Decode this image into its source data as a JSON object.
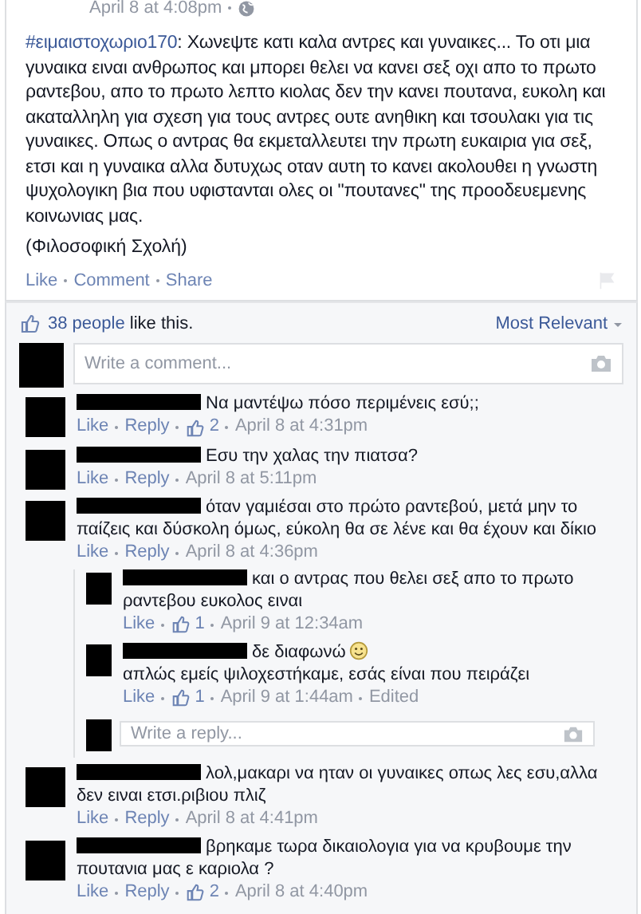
{
  "post": {
    "timestamp": "April 8 at 4:08pm",
    "hashtag": "#ειμαιστοχωριο170",
    "body": ": Χωνεψτε κατι καλα αντρες και γυναικες... Το οτι μια γυναικα ειναι ανθρωπος και μπορει θελει να κανει σεξ οχι απο το πρωτο ραντεβου, απο το πρωτο λεπτο κιολας δεν την κανει πουτανα, ευκολη και ακαταλληλη για σχεση για τους αντρες ουτε ανηθικη και τσουλακι για τις γυναικες. Οπως ο αντρας θα εκμεταλλευτει την πρωτη ευκαιρια για σεξ, ετσι και η γυναικα αλλα δυτυχως οταν αυτη το κανει ακολουθει η γνωστη ψυχολογικη βια που υφιστανται ολες οι \"πουτανες\" της προοδευεμενης κοινωνιας μας.",
    "signature": "(Φιλοσοφική Σχολή)",
    "actions": [
      "Like",
      "Comment",
      "Share"
    ]
  },
  "likes": {
    "count": "38 people",
    "suffix": " like this.",
    "sort": "Most Relevant"
  },
  "comment_box": {
    "placeholder": "Write a comment..."
  },
  "comments": [
    {
      "text": "Να μαντέψω πόσο περιμένεις εσύ;;",
      "actions": [
        "Like",
        "Reply"
      ],
      "likes": "2",
      "time": "April 8 at 4:31pm"
    },
    {
      "text": "Εσυ την χαλας την πιατσα?",
      "actions": [
        "Like",
        "Reply"
      ],
      "time": "April 8 at 5:11pm"
    },
    {
      "text": "όταν γαμιέσαι στο πρώτο ραντεβού, μετά μην το παίζεις και δύσκολη όμως, εύκολη θα σε λένε και θα έχουν και δίκιο",
      "actions": [
        "Like",
        "Reply"
      ],
      "time": "April 8 at 4:36pm",
      "replies": [
        {
          "text": "και ο αντρας που θελει σεξ απο το πρωτο ραντεβου ευκολος ειναι",
          "actions": [
            "Like"
          ],
          "likes": "1",
          "time": "April 9 at 12:34am"
        },
        {
          "text": "δε διαφωνώ",
          "smiley": true,
          "text_after": "απλώς εμείς ψιλοχεστήκαμε, εσάς είναι που πειράζει",
          "actions": [
            "Like"
          ],
          "likes": "1",
          "time": "April 9 at 1:44am",
          "edited": "Edited"
        }
      ],
      "reply_box": {
        "placeholder": "Write a reply..."
      }
    },
    {
      "text": "λολ,μακαρι να ηταν οι γυναικες οπως λες εσυ,αλλα δεν ειναι ετσι.ριβιου πλιζ",
      "actions": [
        "Like",
        "Reply"
      ],
      "time": "April 8 at 4:41pm"
    },
    {
      "text": "βρηκαμε τωρα δικαιολογια για να κρυβουμε την πουτανια μας ε καριολα ?",
      "actions": [
        "Like",
        "Reply"
      ],
      "likes": "2",
      "time": "April 8 at 4:40pm"
    }
  ]
}
